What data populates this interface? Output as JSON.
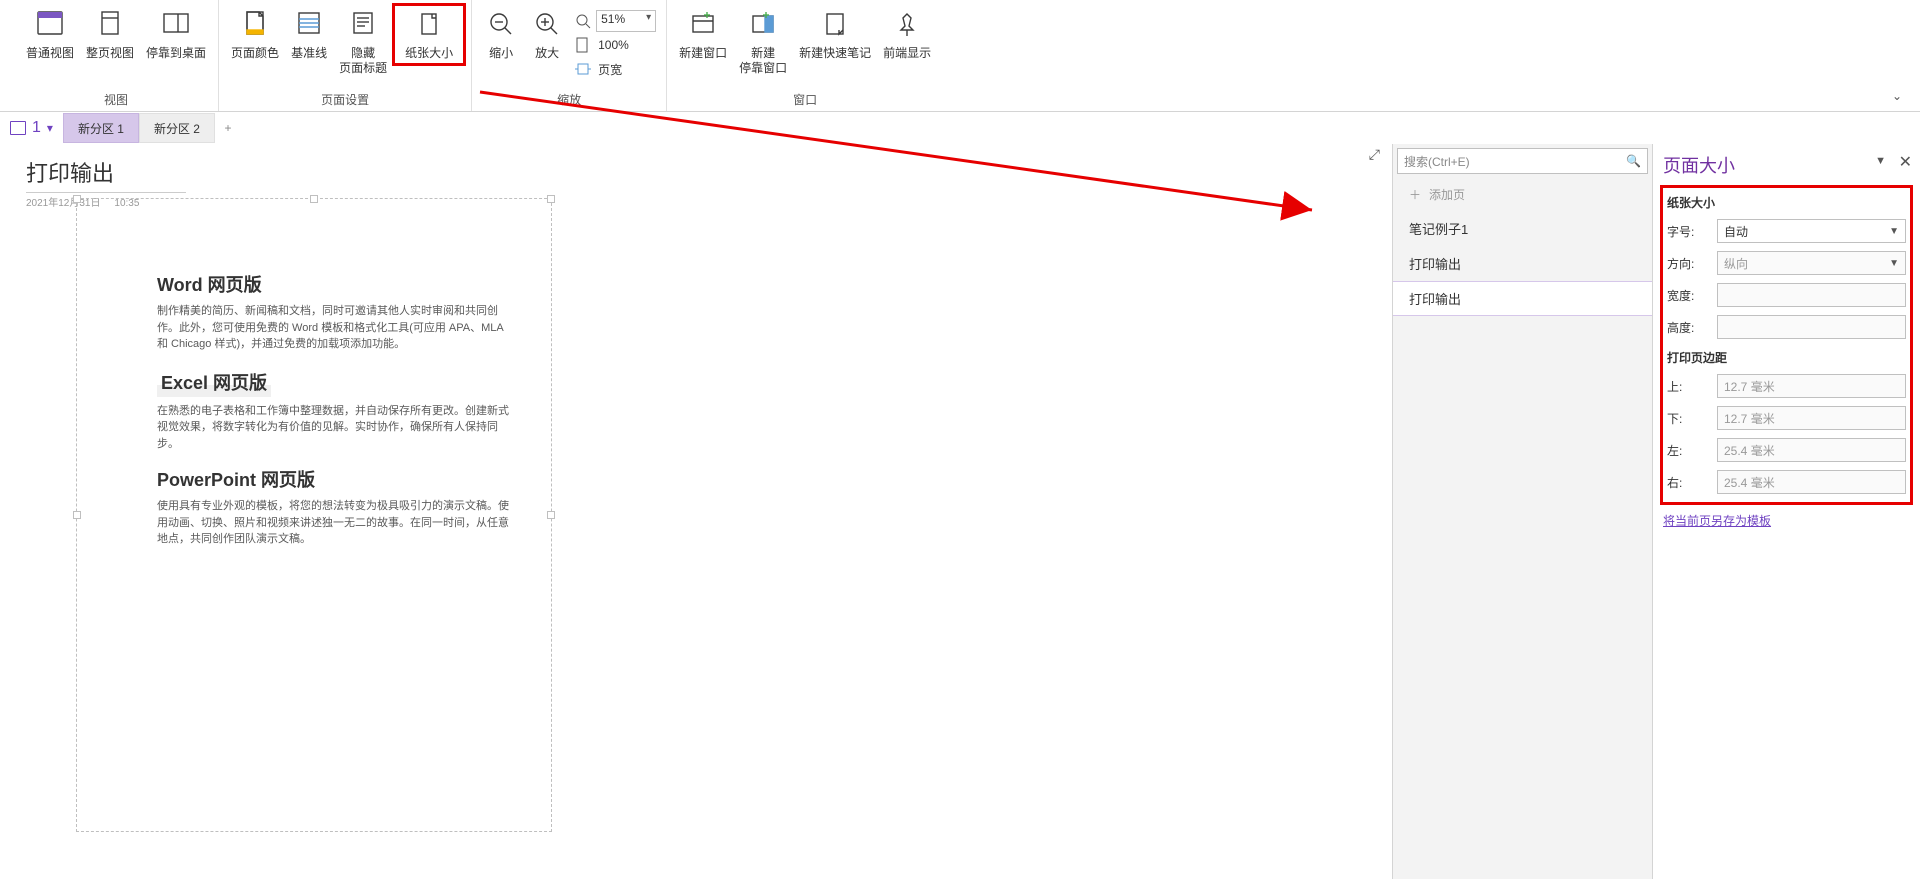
{
  "ribbon": {
    "view": {
      "normal": "普通视图",
      "fullpage": "整页视图",
      "dock": "停靠到桌面",
      "group": "视图"
    },
    "pagesetup": {
      "pagecolor": "页面颜色",
      "rulelines": "基准线",
      "hidetitle": "隐藏\n页面标题",
      "papersize": "纸张大小",
      "group": "页面设置"
    },
    "zoom": {
      "out": "缩小",
      "in": "放大",
      "pct": "51%",
      "p100": "100%",
      "pagewidth": "页宽",
      "group": "缩放"
    },
    "window": {
      "newwin": "新建窗口",
      "newdock": "新建\n停靠窗口",
      "quicknote": "新建快速笔记",
      "ontop": "前端显示",
      "group": "窗口"
    }
  },
  "nb": {
    "notebookNum": "1",
    "tab1": "新分区 1",
    "tab2": "新分区 2",
    "plus": "+"
  },
  "canvas": {
    "title": "打印输出",
    "date": "2021年12月31日",
    "time": "10:35",
    "h1": "Word  网页版",
    "p1": "制作精美的简历、新闻稿和文档，同时可邀请其他人实时审阅和共同创作。此外，您可使用免费的 Word 模板和格式化工具(可应用 APA、MLA 和 Chicago 样式)，并通过免费的加载项添加功能。",
    "h2": "Excel  网页版",
    "p2": "在熟悉的电子表格和工作簿中整理数据，并自动保存所有更改。创建新式视觉效果，将数字转化为有价值的见解。实时协作，确保所有人保持同步。",
    "h3": "PowerPoint  网页版",
    "p3": "使用具有专业外观的模板，将您的想法转变为极具吸引力的演示文稿。使用动画、切换、照片和视频来讲述独一无二的故事。在同一时间，从任意地点，共同创作团队演示文稿。"
  },
  "pagelist": {
    "search": "搜索(Ctrl+E)",
    "addpage": "添加页",
    "items": [
      "笔记例子1",
      "打印输出",
      "打印输出"
    ]
  },
  "pane": {
    "title": "页面大小",
    "sub1": "纸张大小",
    "size_label": "字号:",
    "size_value": "自动",
    "orient_label": "方向:",
    "orient_value": "纵向",
    "width_label": "宽度:",
    "height_label": "高度:",
    "sub2": "打印页边距",
    "top_label": "上:",
    "top_value": "12.7 毫米",
    "bottom_label": "下:",
    "bottom_value": "12.7 毫米",
    "left_label": "左:",
    "left_value": "25.4 毫米",
    "right_label": "右:",
    "right_value": "25.4 毫米",
    "link": "将当前页另存为模板"
  }
}
